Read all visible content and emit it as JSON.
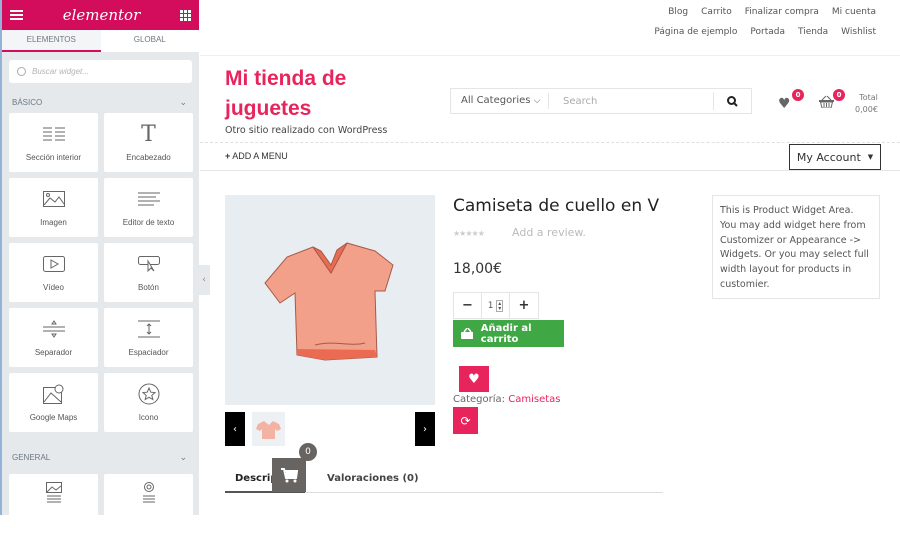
{
  "sidebar": {
    "logo": "elementor",
    "tabs": [
      "ELEMENTOS",
      "GLOBAL"
    ],
    "search_placeholder": "Buscar widget...",
    "sections": [
      {
        "title": "BÁSICO",
        "widgets": [
          {
            "label": "Sección interior",
            "icon": "columns-icon"
          },
          {
            "label": "Encabezado",
            "icon": "heading-icon"
          },
          {
            "label": "Imagen",
            "icon": "image-icon"
          },
          {
            "label": "Editor de texto",
            "icon": "text-editor-icon"
          },
          {
            "label": "Vídeo",
            "icon": "video-icon"
          },
          {
            "label": "Botón",
            "icon": "button-icon"
          },
          {
            "label": "Separador",
            "icon": "divider-icon"
          },
          {
            "label": "Espaciador",
            "icon": "spacer-icon"
          },
          {
            "label": "Google Maps",
            "icon": "map-icon"
          },
          {
            "label": "Icono",
            "icon": "star-icon"
          }
        ]
      },
      {
        "title": "GENERAL",
        "widgets": [
          {
            "label": "",
            "icon": "image-box-icon"
          },
          {
            "label": "",
            "icon": "icon-box-icon"
          }
        ]
      }
    ]
  },
  "header": {
    "top_links_row1": [
      "Blog",
      "Carrito",
      "Finalizar compra",
      "Mi cuenta"
    ],
    "top_links_row2": [
      "Página de ejemplo",
      "Portada",
      "Tienda",
      "Wishlist"
    ],
    "site_title_line1": "Mi tienda de",
    "site_title_line2": "juguetes",
    "tagline": "Otro sitio realizado con WordPress",
    "search": {
      "category": "All Categories",
      "placeholder": "Search"
    },
    "wishlist_count": "0",
    "cart_count": "0",
    "total_label": "Total",
    "total_value": "0,00€",
    "add_menu": "ADD A MENU",
    "my_account": "My Account"
  },
  "product": {
    "title": "Camiseta de cuello en V",
    "rating_stars": "★★★★★",
    "review_link": "Add a review.",
    "price": "18,00€",
    "quantity": "1",
    "add_to_cart": "Añadir al carrito",
    "category_label": "Categoría:",
    "category_value": "Camisetas",
    "tabs": [
      "Descripción",
      "Valoraciones (0)"
    ],
    "floating_cart_count": "0"
  },
  "widget_area": {
    "text": "This is Product Widget Area. You may add widget here from Customizer or Appearance -> Widgets. Or you may select full width layout for products in customier."
  },
  "colors": {
    "brand": "#d30c5c",
    "accent": "#e8245c",
    "cart_green": "#3fa845"
  }
}
